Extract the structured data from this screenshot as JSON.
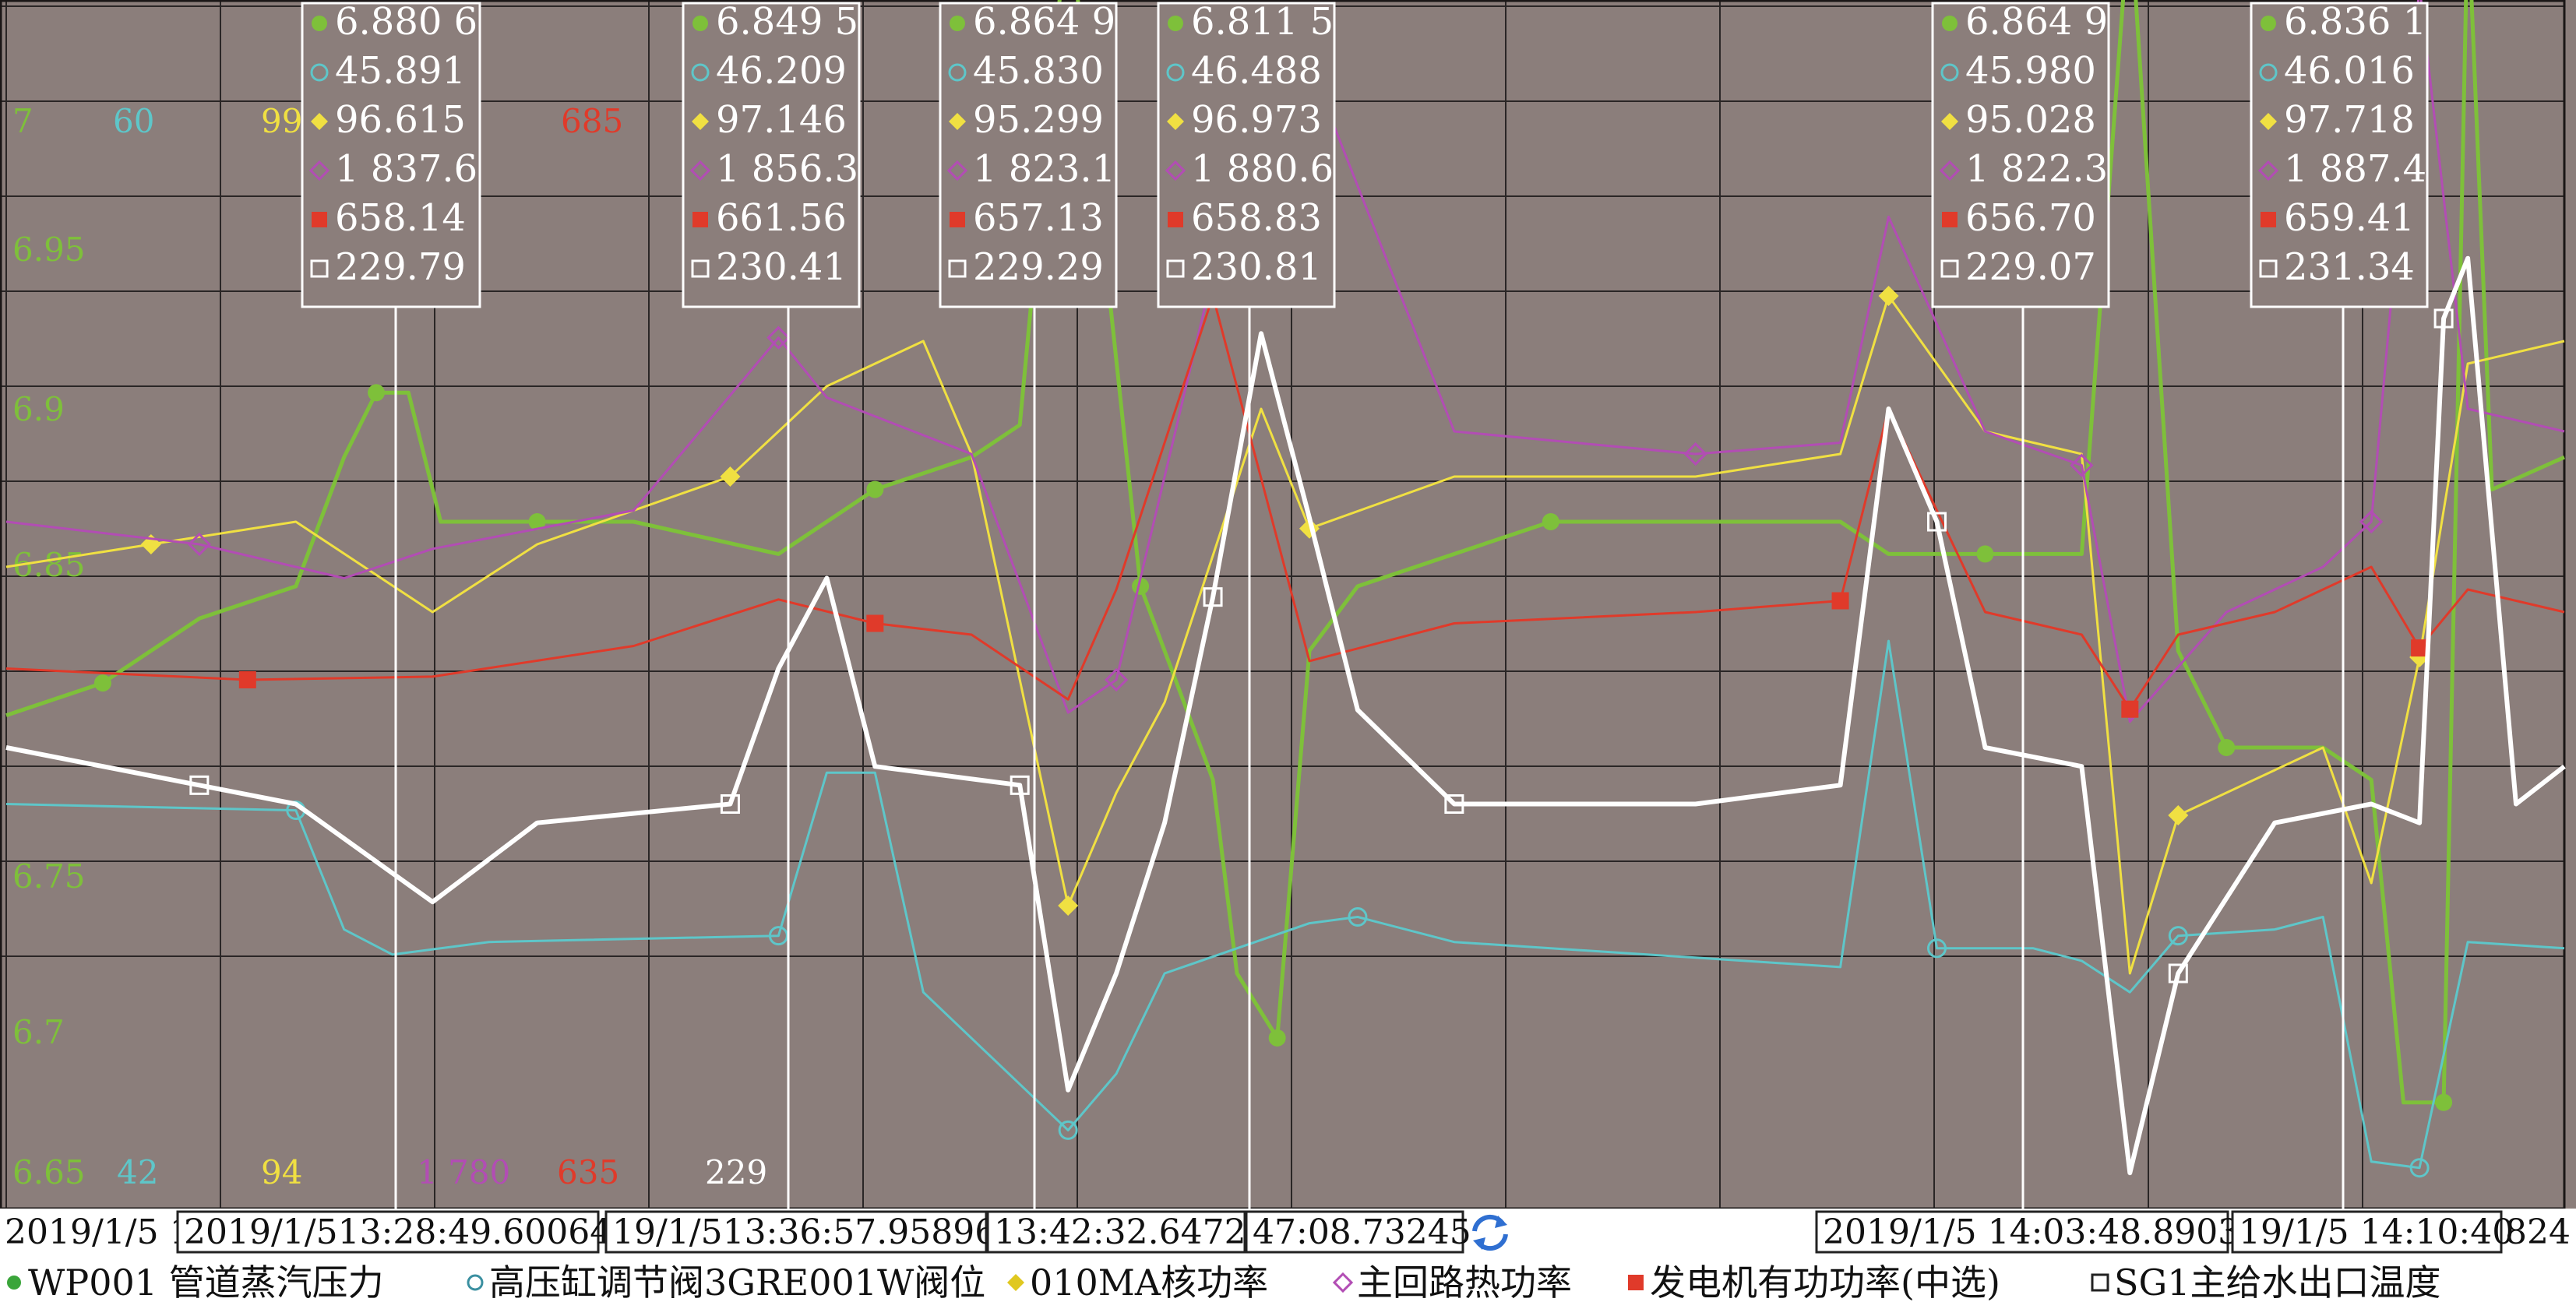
{
  "chart_data": {
    "type": "line",
    "background_color": "#8b7e7b",
    "grid": true,
    "legend_position": "bottom",
    "x_start": "2019/1/5 13:20",
    "x_end": "2019/1/5 14:13",
    "x_corner_label": "2019/1/5 1",
    "x_end_label": "824",
    "refresh_icon": "refresh-icon",
    "axes": [
      {
        "name": "WP001 管道蒸汽压力",
        "color": "#7ec03a",
        "range": [
          6.65,
          7
        ],
        "tick_labels": [
          "7",
          "6.95",
          "6.9",
          "6.85",
          "6.75",
          "6.7",
          "6.65"
        ]
      },
      {
        "name": "高压缸调节阀3GRE001W阀位",
        "color": "#5ec6c9",
        "range": [
          42,
          60
        ],
        "tick_labels": [
          "60",
          "42"
        ]
      },
      {
        "name": "010MA核功率",
        "color": "#f0e042",
        "range": [
          94,
          99
        ],
        "tick_labels": [
          "99",
          "94"
        ]
      },
      {
        "name": "主回路热功率",
        "color": "#b24db4",
        "range": [
          1780,
          1880
        ],
        "tick_labels": [
          "1 780"
        ]
      },
      {
        "name": "发电机有功功率(中选)",
        "color": "#e03a2a",
        "range": [
          635,
          685
        ],
        "tick_labels": [
          "685",
          "635"
        ]
      },
      {
        "name": "SG1主给水出口温度",
        "color": "#ffffff",
        "range": [
          229,
          232
        ],
        "tick_labels": [
          "229"
        ]
      }
    ],
    "series": [
      {
        "name": "WP001 管道蒸汽压力",
        "color": "#7ec03a",
        "marker": "circle",
        "points": [
          [
            "13:20",
            6.8
          ],
          [
            "13:22",
            6.81
          ],
          [
            "13:24",
            6.83
          ],
          [
            "13:26",
            6.84
          ],
          [
            "13:27",
            6.88
          ],
          [
            "13:27:40",
            6.9
          ],
          [
            "13:28:20",
            6.9
          ],
          [
            "13:29",
            6.86
          ],
          [
            "13:30",
            6.86
          ],
          [
            "13:31",
            6.86
          ],
          [
            "13:33",
            6.86
          ],
          [
            "13:36",
            6.85
          ],
          [
            "13:37",
            6.86
          ],
          [
            "13:38",
            6.87
          ],
          [
            "13:40",
            6.88
          ],
          [
            "13:41",
            6.89
          ],
          [
            "13:42",
            7.05
          ],
          [
            "13:43:30",
            6.84
          ],
          [
            "13:44",
            6.82
          ],
          [
            "13:45",
            6.78
          ],
          [
            "13:45:30",
            6.72
          ],
          [
            "13:46:20",
            6.7
          ],
          [
            "13:47",
            6.82
          ],
          [
            "13:48",
            6.84
          ],
          [
            "13:50",
            6.85
          ],
          [
            "13:52",
            6.86
          ],
          [
            "13:55",
            6.86
          ],
          [
            "13:58",
            6.86
          ],
          [
            "13:59",
            6.85
          ],
          [
            "14:01",
            6.85
          ],
          [
            "14:03",
            6.85
          ],
          [
            "14:04",
            7.05
          ],
          [
            "14:05",
            6.82
          ],
          [
            "14:06",
            6.79
          ],
          [
            "14:08",
            6.79
          ],
          [
            "14:09",
            6.78
          ],
          [
            "14:09:40",
            6.68
          ],
          [
            "14:10:30",
            6.68
          ],
          [
            "14:11",
            7.05
          ],
          [
            "14:11:30",
            6.87
          ],
          [
            "14:13",
            6.88
          ]
        ]
      },
      {
        "name": "高压缸调节阀3GRE001W阀位",
        "color": "#5ec6c9",
        "marker": "circle-open",
        "points": [
          [
            "13:20",
            48.3
          ],
          [
            "13:26",
            48.2
          ],
          [
            "13:27",
            46.3
          ],
          [
            "13:28",
            45.9
          ],
          [
            "13:30",
            46.1
          ],
          [
            "13:36",
            46.2
          ],
          [
            "13:37",
            48.8
          ],
          [
            "13:38",
            48.8
          ],
          [
            "13:39",
            45.3
          ],
          [
            "13:42",
            43.1
          ],
          [
            "13:43",
            44.0
          ],
          [
            "13:44",
            45.6
          ],
          [
            "13:47",
            46.4
          ],
          [
            "13:48",
            46.5
          ],
          [
            "13:50",
            46.1
          ],
          [
            "13:58",
            45.7
          ],
          [
            "13:59",
            50.9
          ],
          [
            "14:00",
            46.0
          ],
          [
            "14:02",
            46.0
          ],
          [
            "14:03",
            45.8
          ],
          [
            "14:04",
            45.3
          ],
          [
            "14:05",
            46.2
          ],
          [
            "14:07",
            46.3
          ],
          [
            "14:08",
            46.5
          ],
          [
            "14:09",
            42.6
          ],
          [
            "14:10",
            42.5
          ],
          [
            "14:11",
            46.1
          ],
          [
            "14:13",
            46.0
          ]
        ]
      },
      {
        "name": "010MA核功率",
        "color": "#f0e042",
        "marker": "diamond",
        "points": [
          [
            "13:20",
            96.8
          ],
          [
            "13:23",
            96.9
          ],
          [
            "13:26",
            97.0
          ],
          [
            "13:28:50",
            96.6
          ],
          [
            "13:31",
            96.9
          ],
          [
            "13:35",
            97.2
          ],
          [
            "13:37",
            97.6
          ],
          [
            "13:39",
            97.8
          ],
          [
            "13:40",
            97.3
          ],
          [
            "13:42",
            95.3
          ],
          [
            "13:43",
            95.8
          ],
          [
            "13:44",
            96.2
          ],
          [
            "13:46",
            97.5
          ],
          [
            "13:47",
            96.97
          ],
          [
            "13:50",
            97.2
          ],
          [
            "13:55",
            97.2
          ],
          [
            "13:58",
            97.3
          ],
          [
            "13:59",
            98.0
          ],
          [
            "14:01",
            97.4
          ],
          [
            "14:03",
            97.3
          ],
          [
            "14:04",
            95.0
          ],
          [
            "14:05",
            95.7
          ],
          [
            "14:06",
            95.8
          ],
          [
            "14:08",
            96.0
          ],
          [
            "14:09",
            95.4
          ],
          [
            "14:10",
            96.4
          ],
          [
            "14:11",
            97.7
          ],
          [
            "14:13",
            97.8
          ]
        ]
      },
      {
        "name": "主回路热功率",
        "color": "#b24db4",
        "marker": "diamond-open",
        "points": [
          [
            "13:20",
            1840
          ],
          [
            "13:24",
            1838
          ],
          [
            "13:27",
            1835
          ],
          [
            "13:28:50",
            1837.6
          ],
          [
            "13:33",
            1841
          ],
          [
            "13:36",
            1856.3
          ],
          [
            "13:37",
            1851
          ],
          [
            "13:40",
            1846
          ],
          [
            "13:42",
            1823.1
          ],
          [
            "13:43",
            1826
          ],
          [
            "13:45",
            1862
          ],
          [
            "13:47",
            1880.6
          ],
          [
            "13:50",
            1848
          ],
          [
            "13:55",
            1846
          ],
          [
            "13:58",
            1847
          ],
          [
            "13:59",
            1867
          ],
          [
            "14:01",
            1848
          ],
          [
            "14:03",
            1845
          ],
          [
            "14:04",
            1822.3
          ],
          [
            "14:06",
            1832
          ],
          [
            "14:08",
            1836
          ],
          [
            "14:09",
            1840
          ],
          [
            "14:10",
            1887.4
          ],
          [
            "14:11",
            1850
          ],
          [
            "14:13",
            1848
          ]
        ]
      },
      {
        "name": "发电机有功功率(中选)",
        "color": "#e03a2a",
        "marker": "square",
        "points": [
          [
            "13:20",
            658.5
          ],
          [
            "13:25",
            658.0
          ],
          [
            "13:28:50",
            658.14
          ],
          [
            "13:33",
            659.5
          ],
          [
            "13:36",
            661.56
          ],
          [
            "13:38",
            660.5
          ],
          [
            "13:40",
            660.0
          ],
          [
            "13:42",
            657.13
          ],
          [
            "13:43",
            662.0
          ],
          [
            "13:45",
            675.0
          ],
          [
            "13:47",
            658.83
          ],
          [
            "13:50",
            660.5
          ],
          [
            "13:55",
            661.0
          ],
          [
            "13:58",
            661.5
          ],
          [
            "13:59",
            670.0
          ],
          [
            "14:01",
            661.0
          ],
          [
            "14:03",
            660.0
          ],
          [
            "14:04",
            656.7
          ],
          [
            "14:05",
            660.0
          ],
          [
            "14:07",
            661.0
          ],
          [
            "14:09",
            663.0
          ],
          [
            "14:10",
            659.41
          ],
          [
            "14:11",
            662.0
          ],
          [
            "14:13",
            661.0
          ]
        ]
      },
      {
        "name": "SG1主给水出口温度",
        "color": "#ffffff",
        "marker": "square-open",
        "points": [
          [
            "13:20",
            230.2
          ],
          [
            "13:24",
            230.1
          ],
          [
            "13:26",
            230.05
          ],
          [
            "13:28:50",
            229.79
          ],
          [
            "13:31",
            230.0
          ],
          [
            "13:35",
            230.05
          ],
          [
            "13:36",
            230.41
          ],
          [
            "13:37",
            230.65
          ],
          [
            "13:38",
            230.15
          ],
          [
            "13:41",
            230.1
          ],
          [
            "13:42",
            229.29
          ],
          [
            "13:43",
            229.6
          ],
          [
            "13:44",
            230.0
          ],
          [
            "13:45",
            230.6
          ],
          [
            "13:46",
            231.3
          ],
          [
            "13:47",
            230.81
          ],
          [
            "13:48",
            230.3
          ],
          [
            "13:50",
            230.05
          ],
          [
            "13:55",
            230.05
          ],
          [
            "13:58",
            230.1
          ],
          [
            "13:59",
            231.1
          ],
          [
            "14:00",
            230.8
          ],
          [
            "14:01",
            230.2
          ],
          [
            "14:03",
            230.15
          ],
          [
            "14:04",
            229.07
          ],
          [
            "14:05",
            229.6
          ],
          [
            "14:07",
            230.0
          ],
          [
            "14:09",
            230.05
          ],
          [
            "14:10",
            230.0
          ],
          [
            "14:10:30",
            231.34
          ],
          [
            "14:11",
            231.5
          ],
          [
            "14:12",
            230.05
          ],
          [
            "14:13",
            230.15
          ]
        ]
      }
    ],
    "cursors": [
      {
        "time_label": "2019/1/513:28:49.60064",
        "values": [
          "6.880 6",
          "45.891",
          "96.615",
          "1 837.6",
          "658.14",
          "229.79"
        ]
      },
      {
        "time_label": "19/1/513:36:57.95896",
        "values": [
          "6.849 5",
          "46.209",
          "97.146",
          "1 856.3",
          "661.56",
          "230.41"
        ]
      },
      {
        "time_label": "13:42:32.6472",
        "values": [
          "6.864 9",
          "45.830",
          "95.299",
          "1 823.1",
          "657.13",
          "229.29"
        ]
      },
      {
        "time_label": "47:08.73245",
        "values": [
          "6.811 5",
          "46.488",
          "96.973",
          "1 880.6",
          "658.83",
          "230.81"
        ]
      },
      {
        "time_label": "2019/1/5 14:03:48.8903",
        "values": [
          "6.864 9",
          "45.980",
          "95.028",
          "1 822.3",
          "656.70",
          "229.07"
        ]
      },
      {
        "time_label": "19/1/5 14:10:40",
        "values": [
          "6.836 1",
          "46.016",
          "97.718",
          "1 887.4",
          "659.41",
          "231.34"
        ]
      }
    ]
  }
}
